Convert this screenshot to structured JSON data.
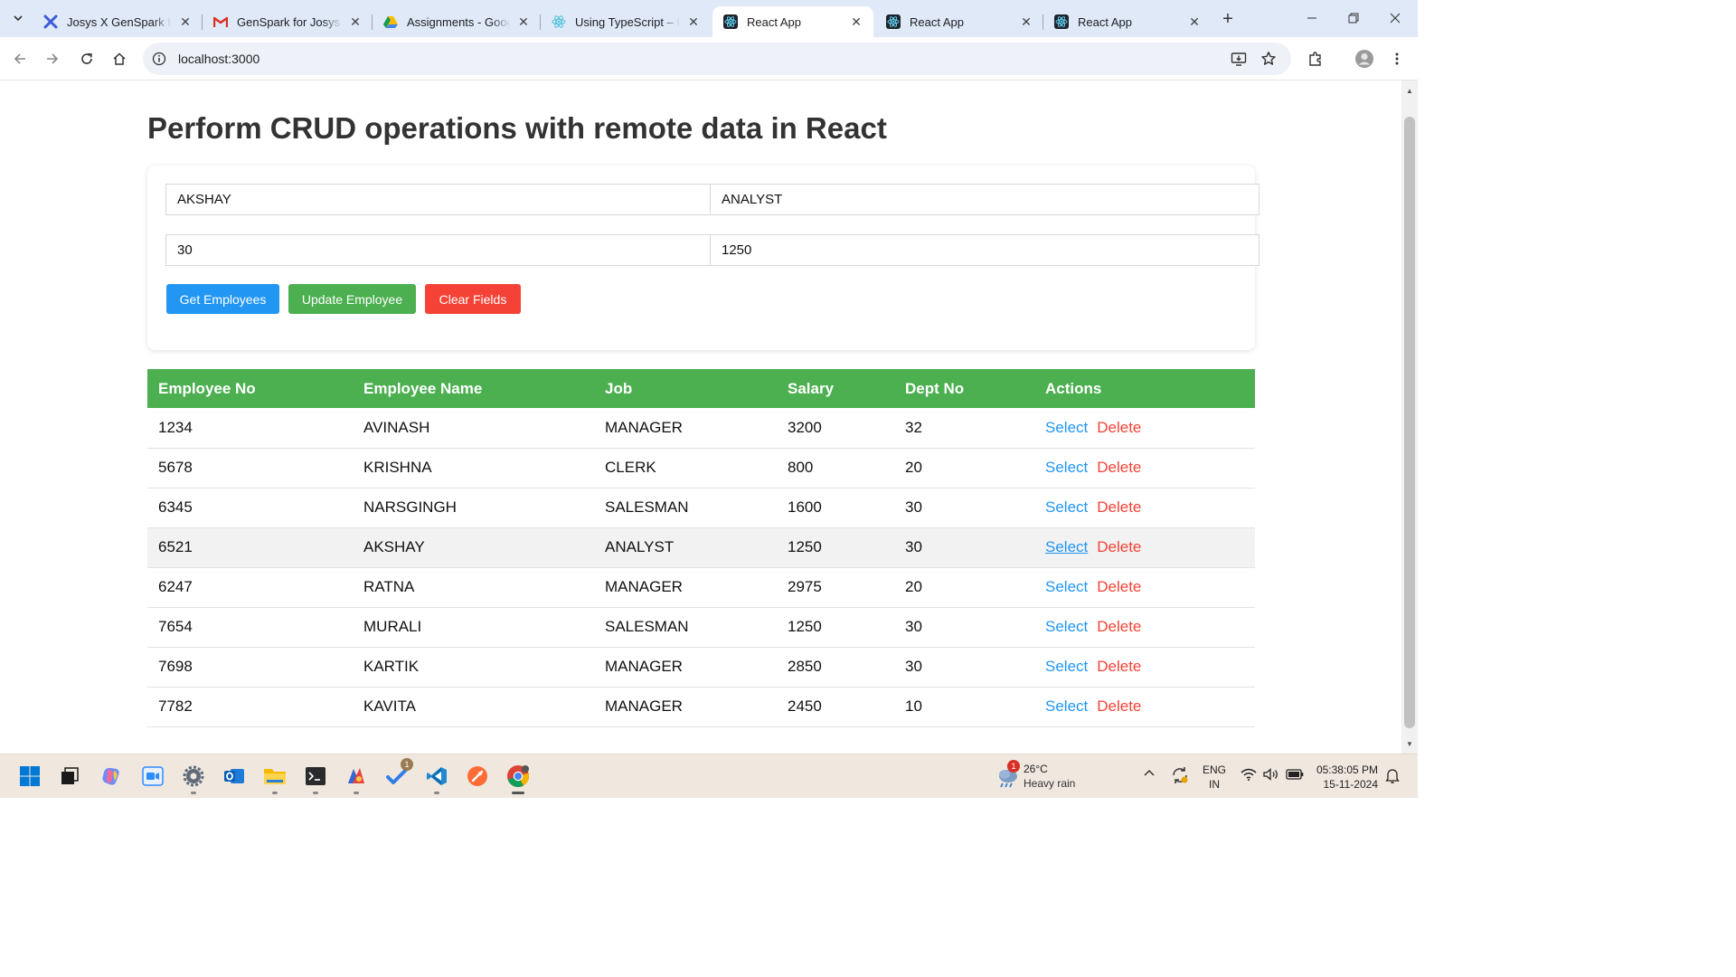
{
  "browser": {
    "tabs": [
      {
        "title": "Josys X GenSpark Ind",
        "favicon": "genspark-icon"
      },
      {
        "title": "GenSpark for Josys |",
        "favicon": "gmail-icon"
      },
      {
        "title": "Assignments - Googl",
        "favicon": "google-drive-icon"
      },
      {
        "title": "Using TypeScript – Re",
        "favicon": "react-icon"
      },
      {
        "title": "React App",
        "favicon": "react-icon",
        "active": true
      },
      {
        "title": "React App",
        "favicon": "react-icon"
      },
      {
        "title": "React App",
        "favicon": "react-icon"
      }
    ],
    "url": "localhost:3000"
  },
  "page": {
    "title": "Perform CRUD operations with remote data in React",
    "form": {
      "name_value": "AKSHAY",
      "job_value": "ANALYST",
      "dept_value": "30",
      "salary_value": "1250"
    },
    "buttons": {
      "get": "Get Employees",
      "update": "Update Employee",
      "clear": "Clear Fields"
    },
    "table": {
      "headers": [
        "Employee No",
        "Employee Name",
        "Job",
        "Salary",
        "Dept No",
        "Actions"
      ],
      "action_labels": {
        "select": "Select",
        "delete": "Delete"
      },
      "rows": [
        [
          "1234",
          "AVINASH",
          "MANAGER",
          "3200",
          "32"
        ],
        [
          "5678",
          "KRISHNA",
          "CLERK",
          "800",
          "20"
        ],
        [
          "6345",
          "NARSGINGH",
          "SALESMAN",
          "1600",
          "30"
        ],
        [
          "6521",
          "AKSHAY",
          "ANALYST",
          "1250",
          "30"
        ],
        [
          "6247",
          "RATNA",
          "MANAGER",
          "2975",
          "20"
        ],
        [
          "7654",
          "MURALI",
          "SALESMAN",
          "1250",
          "30"
        ],
        [
          "7698",
          "KARTIK",
          "MANAGER",
          "2850",
          "30"
        ],
        [
          "7782",
          "KAVITA",
          "MANAGER",
          "2450",
          "10"
        ]
      ],
      "highlighted_row": 3
    }
  },
  "colors": {
    "primary": "#2196f3",
    "success": "#4caf50",
    "danger": "#f44336",
    "header_green": "#4caf50"
  },
  "taskbar": {
    "weather": {
      "temp": "26°C",
      "condition": "Heavy rain",
      "badge": "1"
    },
    "todo_badge": "1",
    "language": {
      "line1": "ENG",
      "line2": "IN"
    },
    "clock": {
      "time": "05:38:05 PM",
      "date": "15-11-2024"
    }
  }
}
